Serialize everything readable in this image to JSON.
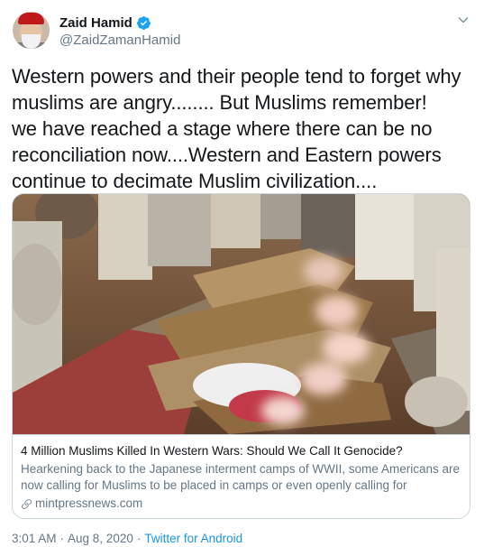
{
  "author": {
    "name": "Zaid Hamid",
    "handle": "@ZaidZamanHamid",
    "verified": true
  },
  "tweet": {
    "text": "Western powers and their people tend to forget why\nmuslims are angry........ But Muslims remember!\nwe have reached a stage where there can be no\nreconciliation now....Western and Eastern powers\ncontinue to decimate Muslim civilization...."
  },
  "card": {
    "title": "4 Million Muslims Killed In Western Wars: Should We Call It Genocide?",
    "description": "Hearkening back to the Japanese interment camps of WWII, some Americans are now calling for Muslims to be placed in camps or even openly calling for genocid...",
    "domain": "mintpressnews.com"
  },
  "meta": {
    "time": "3:01 AM",
    "date": "Aug 8, 2020",
    "source": "Twitter for Android"
  },
  "icons": {
    "verified": "verified-badge-icon",
    "caret": "chevron-down-icon",
    "link": "link-icon"
  },
  "colors": {
    "accent": "#1b95e0",
    "secondary_text": "#657786",
    "border": "#ccd6dd"
  }
}
